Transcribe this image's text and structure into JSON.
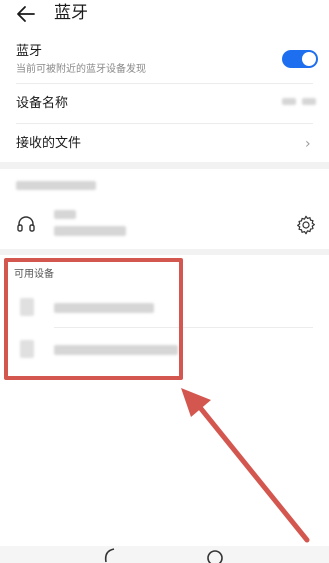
{
  "header": {
    "title": "蓝牙"
  },
  "bluetooth": {
    "label": "蓝牙",
    "subtitle": "当前可被附近的蓝牙设备发现",
    "enabled": true
  },
  "device_name": {
    "label": "设备名称"
  },
  "received_files": {
    "label": "接收的文件"
  },
  "available_devices": {
    "label": "可用设备"
  },
  "colors": {
    "accent": "#1e6ff0",
    "highlight": "#d4574f",
    "divider": "#ececec"
  },
  "icons": [
    "back-arrow-icon",
    "chevron-right-icon",
    "headset-icon",
    "gear-icon"
  ]
}
